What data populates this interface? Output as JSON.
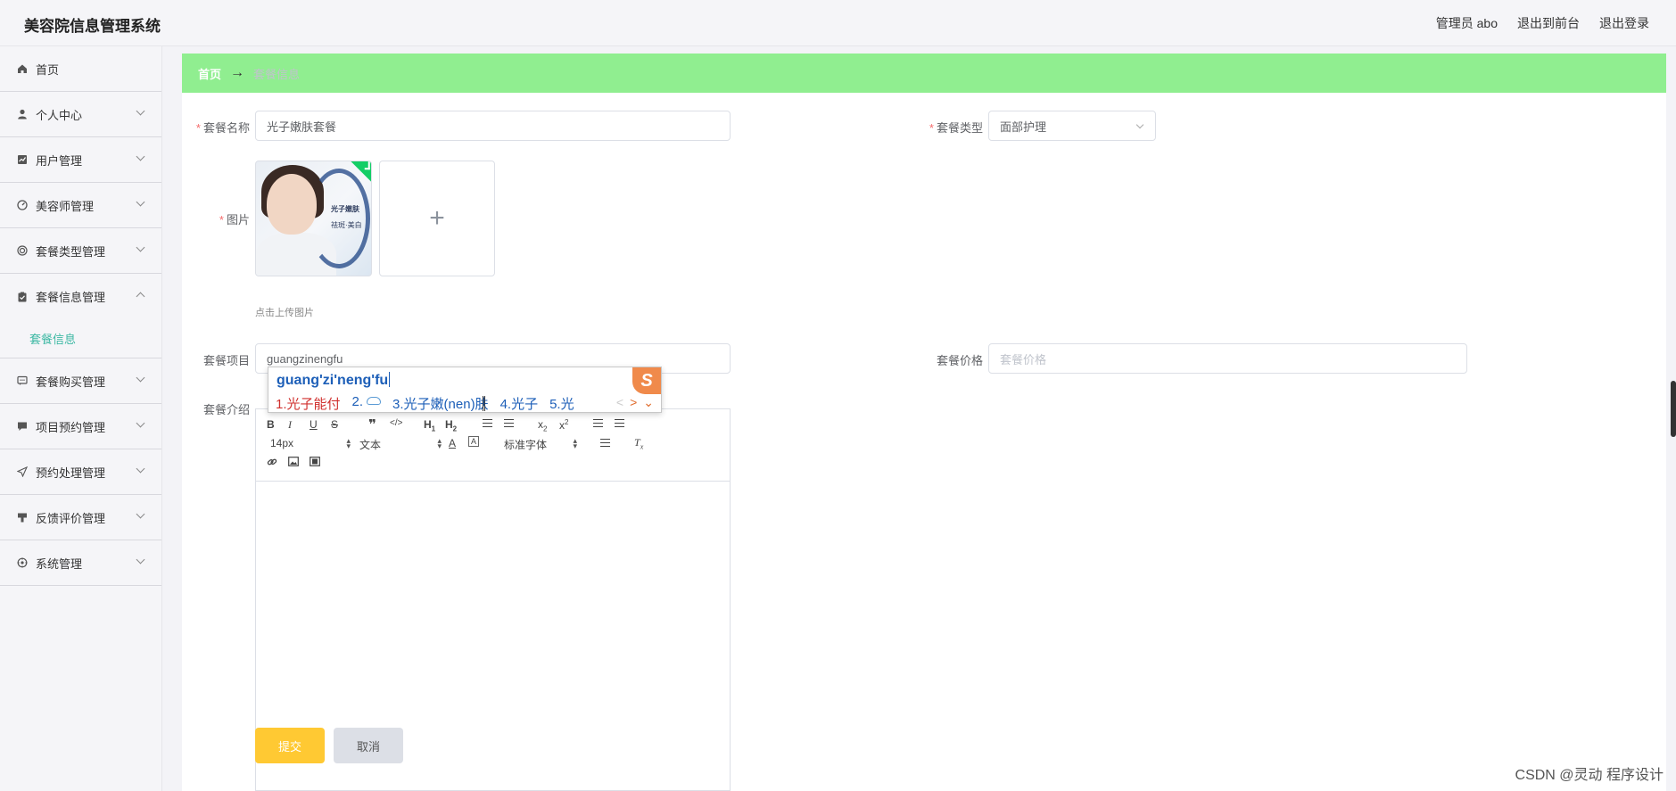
{
  "header": {
    "app_title": "美容院信息管理系统",
    "user_label": "管理员 abo",
    "back_to_front": "退出到前台",
    "logout": "退出登录"
  },
  "sidebar": {
    "items": [
      {
        "label": "首页",
        "icon": "home-icon"
      },
      {
        "label": "个人中心",
        "icon": "user-icon"
      },
      {
        "label": "用户管理",
        "icon": "chart-icon"
      },
      {
        "label": "美容师管理",
        "icon": "dashboard-icon"
      },
      {
        "label": "套餐类型管理",
        "icon": "target-icon"
      },
      {
        "label": "套餐信息管理",
        "icon": "clipboard-icon",
        "expanded": true
      },
      {
        "label": "套餐购买管理",
        "icon": "chat-icon"
      },
      {
        "label": "项目预约管理",
        "icon": "message-icon"
      },
      {
        "label": "预约处理管理",
        "icon": "send-icon"
      },
      {
        "label": "反馈评价管理",
        "icon": "podium-icon"
      },
      {
        "label": "系统管理",
        "icon": "settings-icon"
      }
    ],
    "sub_item": "套餐信息"
  },
  "breadcrumb": {
    "home": "首页",
    "arrow": "→",
    "current": "套餐信息"
  },
  "form": {
    "name_label": "套餐名称",
    "name_value": "光子嫩肤套餐",
    "type_label": "套餐类型",
    "type_value": "面部护理",
    "image_label": "图片",
    "image_text_1": "光子嫩肤",
    "image_text_2": "祛斑·美白",
    "upload_plus": "+",
    "upload_tip": "点击上传图片",
    "project_label": "套餐项目",
    "project_value": "guangzinengfu",
    "price_label": "套餐价格",
    "price_placeholder": "套餐价格",
    "intro_label": "套餐介绍",
    "submit": "提交",
    "cancel": "取消"
  },
  "ime": {
    "composition": "guang'zi'neng'fu",
    "candidates": [
      "1.光子能付",
      "2.",
      "3.光子嫩(nen)肤",
      "4.光子",
      "5.光"
    ],
    "prev": "<",
    "next": ">",
    "more": "⌄",
    "logo": "S"
  },
  "editor": {
    "font_size": "14px",
    "paragraph": "文本",
    "font_family": "标准字体"
  },
  "watermark": "CSDN @灵动 程序设计",
  "colors": {
    "breadcrumb_bg": "#90ee90",
    "active_menu": "#3cb8a3",
    "submit_bg": "#ffc933",
    "required": "#f56c6c"
  }
}
